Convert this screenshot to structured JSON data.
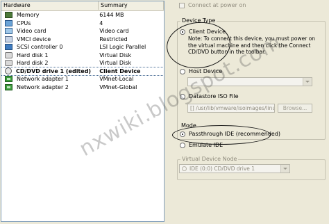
{
  "hardware": {
    "columns": [
      "Hardware",
      "Summary"
    ],
    "rows": [
      {
        "icon": "memory-icon",
        "name": "Memory",
        "summary": "6144 MB",
        "selected": false
      },
      {
        "icon": "cpu-icon",
        "name": "CPUs",
        "summary": "4",
        "selected": false
      },
      {
        "icon": "video-card-icon",
        "name": "Video card",
        "summary": "Video card",
        "selected": false
      },
      {
        "icon": "vmci-icon",
        "name": "VMCI device",
        "summary": "Restricted",
        "selected": false
      },
      {
        "icon": "scsi-controller-icon",
        "name": "SCSI controller 0",
        "summary": "LSI Logic Parallel",
        "selected": false
      },
      {
        "icon": "hard-disk-icon",
        "name": "Hard disk 1",
        "summary": "Virtual Disk",
        "selected": false
      },
      {
        "icon": "hard-disk-icon",
        "name": "Hard disk 2",
        "summary": "Virtual Disk",
        "selected": false
      },
      {
        "icon": "cd-dvd-icon",
        "name": "CD/DVD drive 1 (edited)",
        "summary": "Client Device",
        "selected": true
      },
      {
        "icon": "network-adapter-icon",
        "name": "Network adapter 1",
        "summary": "VMnet-Local",
        "selected": false
      },
      {
        "icon": "network-adapter-icon",
        "name": "Network adapter 2",
        "summary": "VMnet-Global",
        "selected": false
      }
    ]
  },
  "connect_at_power_on": {
    "label": "Connect at power on",
    "checked": false
  },
  "device_type": {
    "title": "Device Type",
    "client_device": {
      "label": "Client Device",
      "selected": true
    },
    "note": "Note: To connect this device, you must power on the virtual machine and then click the Connect CD/DVD button in the toolbar.",
    "host_device": {
      "label": "Host Device",
      "selected": false
    },
    "datastore_iso": {
      "label": "Datastore ISO File",
      "selected": false,
      "path": "[] /usr/lib/vmware/isoimages/linux.iso",
      "browse_label": "Browse..."
    }
  },
  "mode": {
    "title": "Mode",
    "passthrough": {
      "label": "Passthrough IDE (recommended)",
      "selected": true
    },
    "emulate": {
      "label": "Emulate IDE",
      "selected": false
    }
  },
  "virtual_device_node": {
    "title": "Virtual Device Node",
    "value": "IDE (0:0) CD/DVD drive 1"
  },
  "watermark": "nxwiki.blogspot.com"
}
